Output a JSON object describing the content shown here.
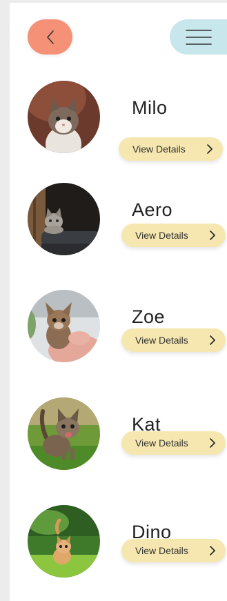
{
  "header": {
    "back_icon": "chevron-left-icon",
    "menu_icon": "hamburger-menu-icon"
  },
  "pets": [
    {
      "name": "Milo",
      "button_label": "View Details",
      "photo": "kitten-portrait"
    },
    {
      "name": "Aero",
      "button_label": "View Details",
      "photo": "kitten-on-chair"
    },
    {
      "name": "Zoe",
      "button_label": "View Details",
      "photo": "kitten-in-hands"
    },
    {
      "name": "Kat",
      "button_label": "View Details",
      "photo": "kitten-in-grass"
    },
    {
      "name": "Dino",
      "button_label": "View Details",
      "photo": "kitten-in-meadow"
    }
  ],
  "colors": {
    "back_button": "#f49177",
    "menu_button": "#c7e7ec",
    "details_button": "#f6e7b0",
    "text": "#222222"
  }
}
